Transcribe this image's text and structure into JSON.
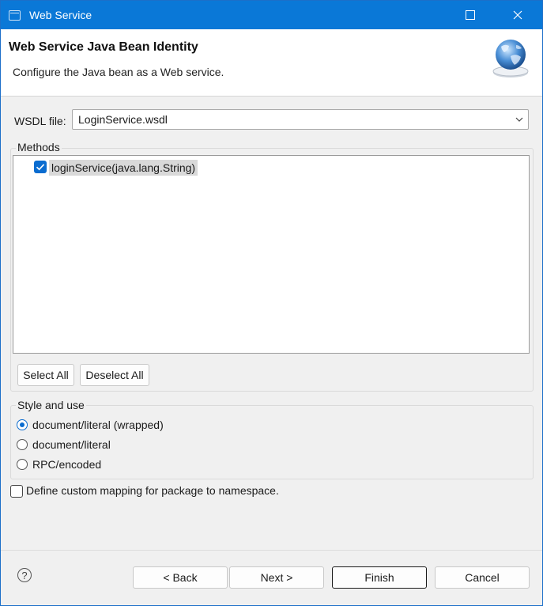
{
  "window": {
    "title": "Web Service",
    "accent": "#0a78d7"
  },
  "banner": {
    "heading": "Web Service Java Bean Identity",
    "description": "Configure the Java bean as a Web service."
  },
  "wsdl": {
    "label": "WSDL file:",
    "value": "LoginService.wsdl"
  },
  "methods": {
    "group_label": "Methods",
    "items": [
      {
        "label": "loginService(java.lang.String)",
        "checked": true
      }
    ],
    "select_all": "Select All",
    "deselect_all": "Deselect All"
  },
  "style": {
    "group_label": "Style and use",
    "options": [
      {
        "label": "document/literal (wrapped)",
        "selected": true
      },
      {
        "label": "document/literal",
        "selected": false
      },
      {
        "label": "RPC/encoded",
        "selected": false
      }
    ]
  },
  "custom_mapping": {
    "label": "Define custom mapping for package to namespace.",
    "checked": false
  },
  "footer": {
    "help_icon": "?",
    "back": "< Back",
    "next": "Next >",
    "finish": "Finish",
    "cancel": "Cancel"
  }
}
